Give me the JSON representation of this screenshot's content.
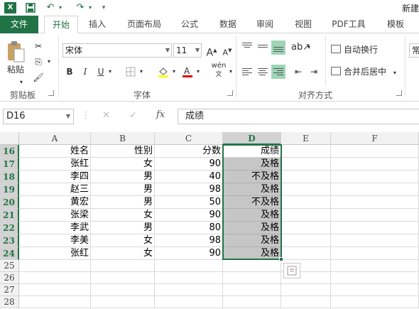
{
  "app": {
    "logo_text": "X",
    "title": "新建",
    "quick_access": {
      "save": "💾",
      "undo": "↶",
      "redo": "↷",
      "more": "▾"
    }
  },
  "tabs": [
    {
      "label": "文件"
    },
    {
      "label": "开始"
    },
    {
      "label": "插入"
    },
    {
      "label": "页面布局"
    },
    {
      "label": "公式"
    },
    {
      "label": "数据"
    },
    {
      "label": "审阅"
    },
    {
      "label": "视图"
    },
    {
      "label": "PDF工具"
    },
    {
      "label": "模板"
    }
  ],
  "ribbon": {
    "clipboard": {
      "paste": "粘贴",
      "group": "剪贴板"
    },
    "font": {
      "name": "宋体",
      "size": "11",
      "grow": "A",
      "shrink": "A",
      "bold": "B",
      "italic": "I",
      "underline": "U",
      "phonetic": "wén",
      "group": "字体"
    },
    "alignment": {
      "wrap_text": "自动换行",
      "merge_center": "合并后居中",
      "group": "对齐方式"
    },
    "number": {
      "format": "常"
    }
  },
  "formula_bar": {
    "name_box": "D16",
    "cancel": "✕",
    "enter": "✓",
    "fx": "fx",
    "content": "成绩"
  },
  "sheet": {
    "columns": [
      "A",
      "B",
      "C",
      "D",
      "E",
      "F"
    ],
    "selected_column": "D",
    "rows": [
      {
        "num": "16",
        "a": "姓名",
        "b": "性别",
        "c": "分数",
        "d": "成绩"
      },
      {
        "num": "17",
        "a": "张红",
        "b": "女",
        "c": "90",
        "d": "及格"
      },
      {
        "num": "18",
        "a": "李四",
        "b": "男",
        "c": "40",
        "d": "不及格"
      },
      {
        "num": "19",
        "a": "赵三",
        "b": "男",
        "c": "98",
        "d": "及格"
      },
      {
        "num": "20",
        "a": "黄宏",
        "b": "男",
        "c": "50",
        "d": "不及格"
      },
      {
        "num": "21",
        "a": "张梁",
        "b": "女",
        "c": "90",
        "d": "及格"
      },
      {
        "num": "22",
        "a": "李武",
        "b": "男",
        "c": "80",
        "d": "及格"
      },
      {
        "num": "23",
        "a": "李美",
        "b": "女",
        "c": "98",
        "d": "及格"
      },
      {
        "num": "24",
        "a": "张红",
        "b": "女",
        "c": "90",
        "d": "及格"
      },
      {
        "num": "25",
        "a": "",
        "b": "",
        "c": "",
        "d": ""
      },
      {
        "num": "26",
        "a": "",
        "b": "",
        "c": "",
        "d": ""
      },
      {
        "num": "27",
        "a": "",
        "b": "",
        "c": "",
        "d": ""
      },
      {
        "num": "28",
        "a": "",
        "b": "",
        "c": "",
        "d": ""
      }
    ]
  },
  "colors": {
    "accent": "#217346",
    "selection_fill": "#c6c6c6",
    "header_bg": "#f2f2f2"
  }
}
